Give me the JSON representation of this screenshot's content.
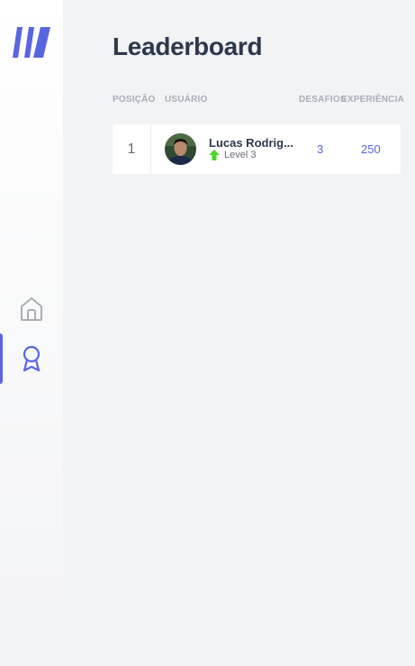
{
  "page": {
    "title": "Leaderboard"
  },
  "sidebar": {
    "logo": "moveit-logo",
    "items": [
      {
        "name": "home",
        "icon": "home-icon",
        "active": false
      },
      {
        "name": "leaderboard",
        "icon": "award-icon",
        "active": true
      }
    ]
  },
  "table": {
    "headers": {
      "position": "POSIÇÃO",
      "user": "USUÁRIO",
      "challenges": "DESAFIOS",
      "experience": "EXPERIÊNCIA"
    },
    "rows": [
      {
        "position": "1",
        "name": "Lucas Rodrig...",
        "level": "Level 3",
        "challenges": "3",
        "experience": "250"
      }
    ]
  },
  "colors": {
    "accent": "#5965e0",
    "level_up": "#4cd62b",
    "title": "#2e384d",
    "background": "#f2f3f5"
  }
}
